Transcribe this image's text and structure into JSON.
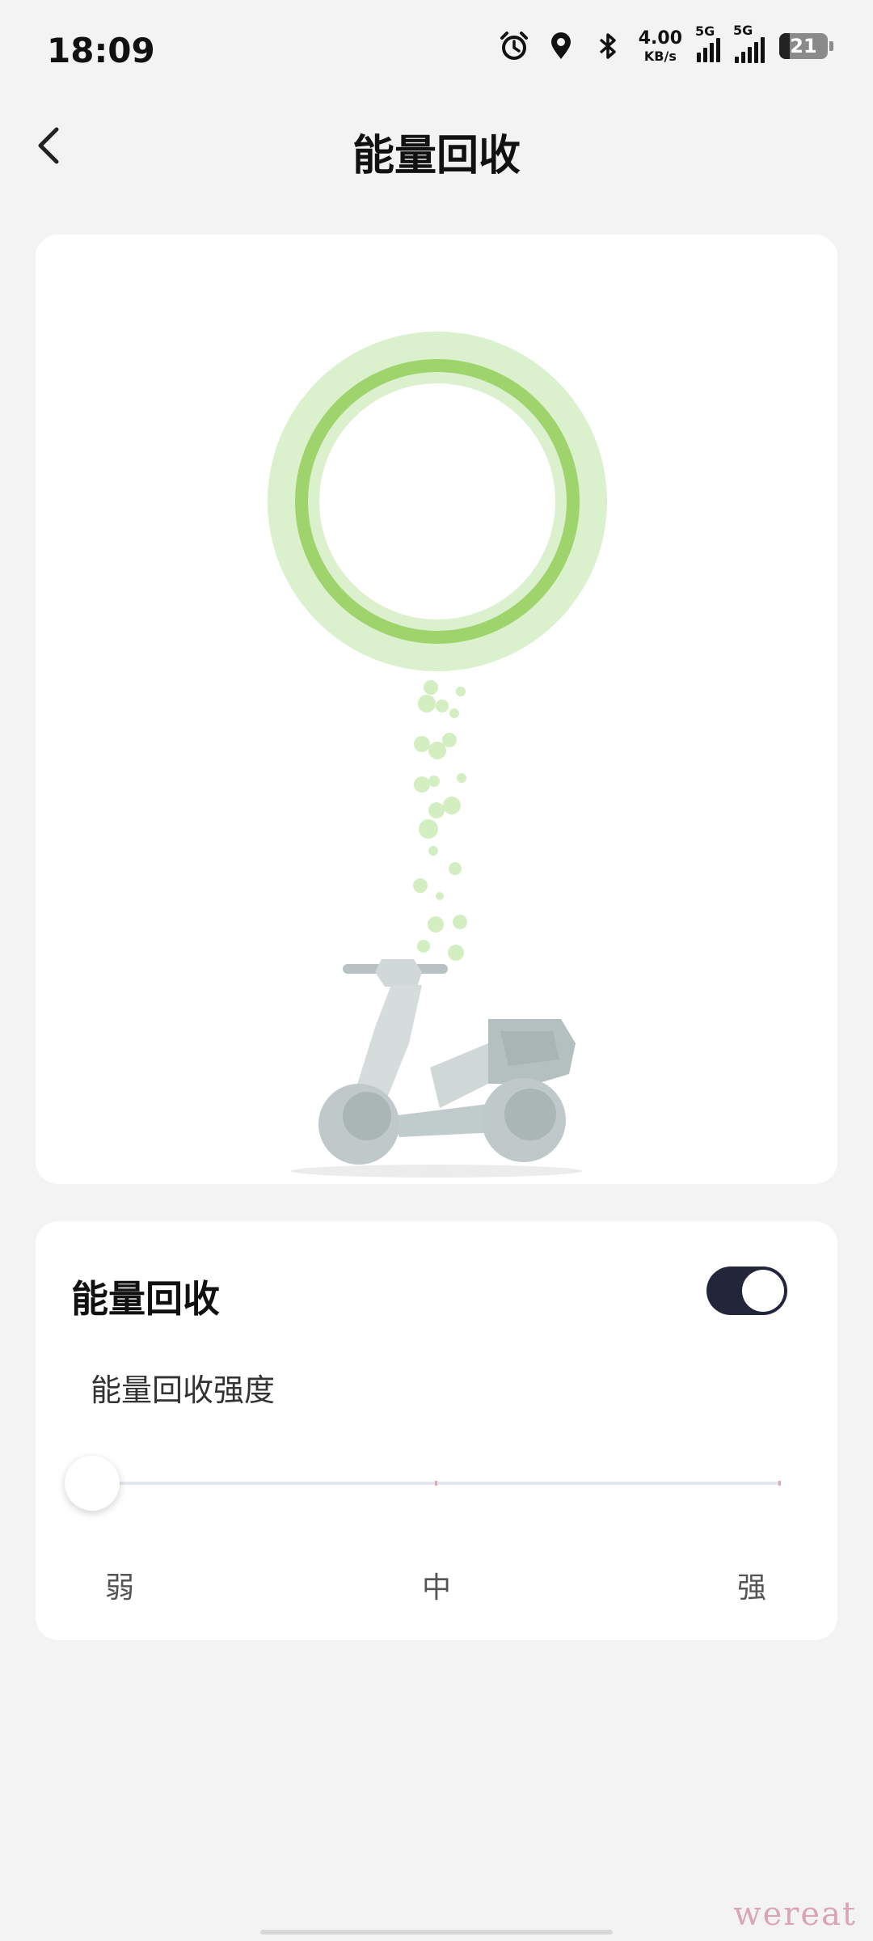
{
  "status_bar": {
    "time": "18:09",
    "net_speed_value": "4.00",
    "net_speed_unit": "KB/s",
    "signal1_tag": "5G",
    "signal2_tag": "5G",
    "battery_level": "21"
  },
  "header": {
    "title": "能量回收",
    "back_icon": "chevron-left-icon"
  },
  "illustration": {
    "accent_color": "#9ed46b",
    "halo_color": "#dbf0cc",
    "scooter_color": "#c6cfcf"
  },
  "control": {
    "title": "能量回收",
    "toggle_on": true,
    "intensity_label": "能量回收强度",
    "levels": [
      "弱",
      "中",
      "强"
    ],
    "selected_level": "弱"
  },
  "watermark": "wereat"
}
